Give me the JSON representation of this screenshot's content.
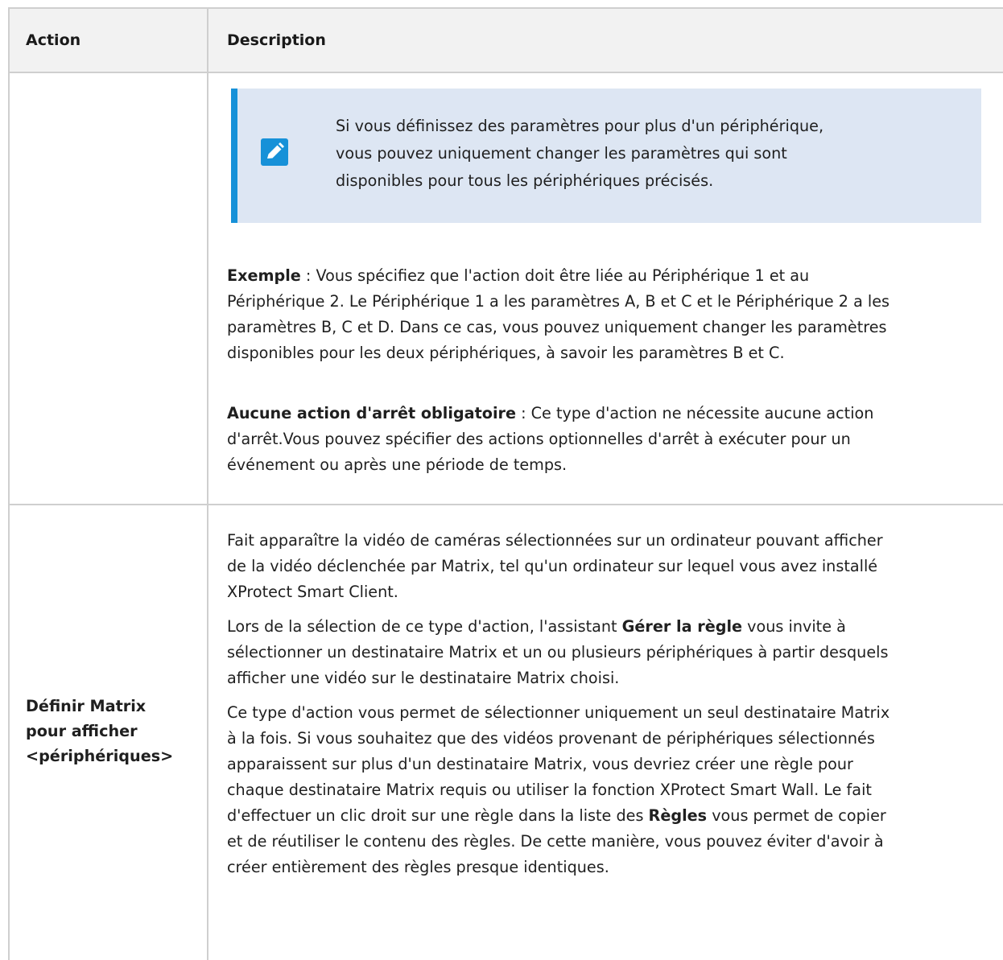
{
  "table": {
    "headers": {
      "action": "Action",
      "description": "Description"
    },
    "row1": {
      "note": {
        "icon": "pencil-icon",
        "lines": [
          "Si vous définissez des paramètres pour plus d'un périphérique,",
          "vous pouvez uniquement changer les paramètres qui sont",
          "disponibles pour tous les périphériques précisés."
        ]
      },
      "example": {
        "label": "Exemple",
        "lines": [
          " : Vous spécifiez que l'action doit être liée au Périphérique 1 et au",
          "Périphérique 2. Le Périphérique 1 a les paramètres A, B et C et le Périphérique 2 a les",
          "paramètres B, C et D. Dans ce cas, vous pouvez uniquement changer les paramètres",
          "disponibles pour les deux périphériques, à savoir les paramètres B et C."
        ]
      },
      "stop": {
        "label": "Aucune action d'arrêt obligatoire",
        "lines": [
          " : Ce type d'action ne nécessite aucune action",
          "d'arrêt.Vous pouvez spécifier des actions optionnelles d'arrêt à exécuter pour un",
          "événement ou après une période de temps."
        ]
      }
    },
    "row2": {
      "action_lines": [
        "Définir Matrix",
        "pour afficher",
        "<périphériques>"
      ],
      "para1": [
        "Fait apparaître la vidéo de caméras sélectionnées sur un ordinateur pouvant afficher",
        "de la vidéo déclenchée par Matrix, tel qu'un ordinateur sur lequel vous avez installé",
        "XProtect Smart Client."
      ],
      "para2": {
        "pre": "Lors de la sélection de ce type d'action, l'assistant ",
        "bold": "Gérer la règle",
        "post": " vous invite à",
        "lines": [
          "sélectionner un destinataire Matrix et un ou plusieurs périphériques à partir desquels",
          "afficher une vidéo sur le destinataire Matrix choisi."
        ]
      },
      "para3": {
        "lines_a": [
          "Ce type d'action vous permet de sélectionner uniquement un seul destinataire Matrix",
          "à la fois. Si vous souhaitez que des vidéos provenant de périphériques sélectionnés",
          "apparaissent sur plus d'un destinataire Matrix, vous devriez créer une règle pour",
          "chaque destinataire Matrix requis ou utiliser la fonction XProtect Smart Wall. Le fait"
        ],
        "line5_pre": "d'effectuer un clic droit sur une règle dans la liste des ",
        "line5_bold": "Règles",
        "line5_post": " vous permet de copier",
        "lines_b": [
          "et de réutiliser le contenu des règles. De cette manière, vous pouvez éviter d'avoir à",
          "créer entièrement des règles presque identiques."
        ]
      }
    }
  }
}
